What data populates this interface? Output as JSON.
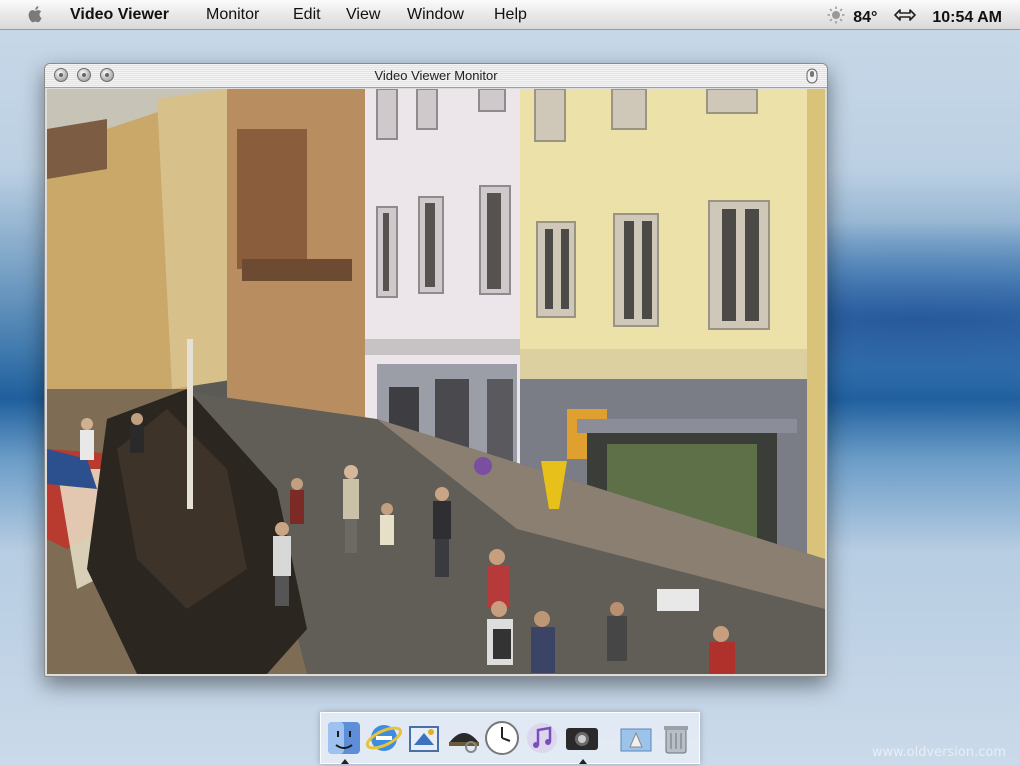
{
  "menubar": {
    "apple_icon": "apple-logo-icon",
    "items": [
      "Video Viewer",
      "Monitor",
      "Edit",
      "View",
      "Window",
      "Help"
    ],
    "status": {
      "temperature": "84°",
      "clock": "10:54 AM"
    }
  },
  "window": {
    "title": "Video Viewer Monitor",
    "buttons": [
      "close-icon",
      "minimize-icon",
      "zoom-icon"
    ],
    "content": "live-street-camera-feed"
  },
  "dock": {
    "items": [
      {
        "name": "finder-icon",
        "running": true
      },
      {
        "name": "internet-explorer-icon",
        "running": false
      },
      {
        "name": "mail-icon",
        "running": false
      },
      {
        "name": "sherlock-icon",
        "running": false
      },
      {
        "name": "clock-icon",
        "running": false
      },
      {
        "name": "itunes-icon",
        "running": false
      },
      {
        "name": "video-viewer-icon",
        "running": true
      },
      {
        "name": "applications-folder-icon",
        "running": false
      },
      {
        "name": "trash-icon",
        "running": false
      }
    ]
  },
  "watermark": "www.oldversion.com",
  "colors": {
    "desktop": "#3f79ad",
    "menubar": "#e7e7e7"
  }
}
